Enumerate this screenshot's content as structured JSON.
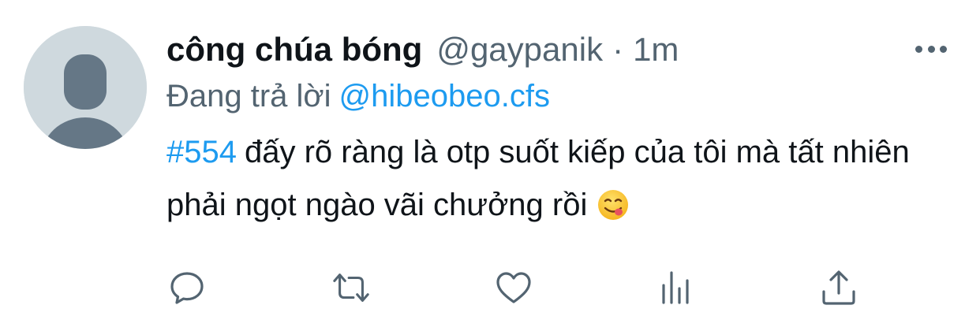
{
  "tweet": {
    "author": {
      "display_name": "công chúa bóng",
      "handle": "@gaypanik"
    },
    "separator": "·",
    "timestamp": "1m",
    "reply_label": "Đang trả lời",
    "reply_to": "@hibeobeo.cfs",
    "hashtag": "#554",
    "body": "đấy rõ ràng là otp suốt kiếp của tôi mà tất nhiên phải ngọt ngào vãi chưởng rồi",
    "emoji": "face-savoring-food-emoji"
  },
  "icons": {
    "more": "more-horizontal-icon",
    "reply": "reply-bubble-icon",
    "retweet": "retweet-icon",
    "like": "heart-icon",
    "analytics": "analytics-bars-icon",
    "share": "share-upload-icon"
  },
  "colors": {
    "text_primary": "#0f1419",
    "text_secondary": "#536471",
    "link_blue": "#1d9bf0",
    "avatar_bg": "#cfd9de",
    "avatar_fg": "#657786"
  }
}
